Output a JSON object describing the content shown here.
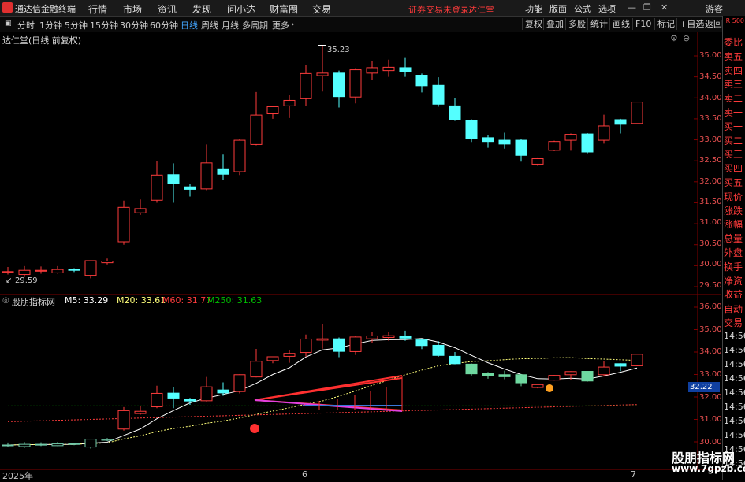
{
  "menubar": {
    "title": "通达信金融终端",
    "items": [
      "行情",
      "市场",
      "资讯",
      "发现",
      "问小达",
      "财富圈",
      "交易"
    ],
    "warning": "证券交易未登录",
    "stock": "达仁堂",
    "right_items": [
      "功能",
      "版面",
      "公式",
      "选项"
    ],
    "guest": "游客"
  },
  "toolbar": {
    "periods": [
      "分时",
      "1分钟",
      "5分钟",
      "15分钟",
      "30分钟",
      "60分钟",
      "日线",
      "周线",
      "月线",
      "多周期",
      "更多"
    ],
    "active": "日线",
    "buttons": [
      "复权",
      "叠加",
      "多股",
      "统计",
      "画线",
      "F10",
      "标记",
      "+自选",
      "返回"
    ]
  },
  "main_chart": {
    "title": "达仁堂(日线 前复权)",
    "high_label": "35.23",
    "low_label": "29.59",
    "y_ticks": [
      "35.00",
      "34.50",
      "34.00",
      "33.50",
      "33.00",
      "32.50",
      "32.00",
      "31.50",
      "31.00",
      "30.50",
      "30.00",
      "29.50"
    ]
  },
  "indicator": {
    "name": "股朋指标网",
    "ma5_label": "M5:",
    "ma5": "33.29",
    "ma20_label": "M20:",
    "ma20": "33.61",
    "ma60_label": "M60:",
    "ma60": "31.77",
    "ma250_label": "M250:",
    "ma250": "31.63",
    "y_ticks": [
      "36.00",
      "35.00",
      "34.00",
      "33.00",
      "32.00",
      "31.00",
      "30.00"
    ],
    "price_tag": "32.22",
    "buy_mark": "买"
  },
  "side_panel": {
    "top_badge": "R 500",
    "items": [
      "委比",
      "卖五",
      "卖四",
      "卖三",
      "卖二",
      "卖一",
      "买一",
      "买二",
      "买三",
      "买四",
      "买五",
      "现价",
      "涨跌",
      "涨幅",
      "总量",
      "外盘",
      "换手",
      "净资",
      "收益"
    ],
    "auto_trade": "自动",
    "trade": "交易",
    "times": [
      "14:56",
      "14:56",
      "14:56",
      "14:56",
      "14:56",
      "14:56",
      "14:56",
      "14:56",
      "14:56",
      "14:56"
    ]
  },
  "x_axis": {
    "labels": [
      "2025年",
      "6",
      "7"
    ]
  },
  "watermark": {
    "line1": "股朋指标网",
    "line2": "www.7gpzb.com"
  },
  "colors": {
    "up": "#ff3c3c",
    "down": "#54ffff",
    "ma5": "#ffffff",
    "ma20": "#ffff7a",
    "ma60": "#ff3c3c",
    "ma250": "#00c000",
    "accent": "#42a5ff"
  },
  "chart_data": {
    "type": "candlestick",
    "title": "达仁堂(日线 前复权)",
    "ylim": [
      29.5,
      35.2
    ],
    "candles": [
      [
        29.84,
        29.86,
        29.97,
        29.79
      ],
      [
        29.79,
        29.89,
        29.99,
        29.73
      ],
      [
        29.87,
        29.89,
        29.98,
        29.81
      ],
      [
        29.83,
        29.91,
        29.99,
        29.81
      ],
      [
        29.92,
        29.89,
        29.94,
        29.85
      ],
      [
        29.77,
        30.12,
        30.13,
        29.7
      ],
      [
        30.07,
        30.11,
        30.17,
        30.03
      ],
      [
        30.57,
        31.39,
        31.55,
        30.5
      ],
      [
        31.26,
        31.36,
        31.58,
        31.21
      ],
      [
        31.56,
        32.16,
        32.5,
        31.5
      ],
      [
        32.17,
        31.95,
        32.44,
        31.5
      ],
      [
        31.88,
        31.82,
        31.96,
        31.65
      ],
      [
        31.83,
        32.45,
        32.89,
        31.8
      ],
      [
        32.31,
        32.18,
        32.65,
        32.05
      ],
      [
        32.24,
        32.99,
        33.01,
        32.16
      ],
      [
        32.89,
        33.59,
        34.14,
        32.87
      ],
      [
        33.62,
        33.79,
        33.8,
        33.5
      ],
      [
        33.81,
        33.94,
        34.07,
        33.52
      ],
      [
        33.98,
        34.58,
        34.78,
        33.8
      ],
      [
        34.53,
        34.59,
        35.23,
        34.15
      ],
      [
        34.59,
        34.03,
        34.65,
        33.77
      ],
      [
        34.02,
        34.67,
        34.71,
        33.87
      ],
      [
        34.59,
        34.72,
        34.88,
        34.42
      ],
      [
        34.65,
        34.73,
        34.91,
        34.5
      ],
      [
        34.72,
        34.62,
        34.95,
        34.5
      ],
      [
        34.54,
        34.29,
        34.58,
        34.13
      ],
      [
        34.3,
        33.85,
        34.49,
        33.79
      ],
      [
        33.81,
        33.48,
        34.0,
        33.45
      ],
      [
        33.46,
        33.03,
        33.49,
        32.95
      ],
      [
        33.05,
        32.96,
        33.11,
        32.81
      ],
      [
        32.99,
        32.9,
        33.17,
        32.79
      ],
      [
        32.99,
        32.63,
        33.02,
        32.48
      ],
      [
        32.42,
        32.55,
        32.58,
        32.38
      ],
      [
        32.75,
        32.96,
        32.98,
        32.73
      ],
      [
        32.99,
        33.13,
        33.15,
        32.74
      ],
      [
        33.14,
        32.71,
        33.16,
        32.68
      ],
      [
        32.99,
        33.33,
        33.6,
        32.91
      ],
      [
        33.48,
        33.37,
        33.5,
        33.15
      ],
      [
        33.39,
        33.9,
        33.9,
        33.37
      ]
    ]
  }
}
